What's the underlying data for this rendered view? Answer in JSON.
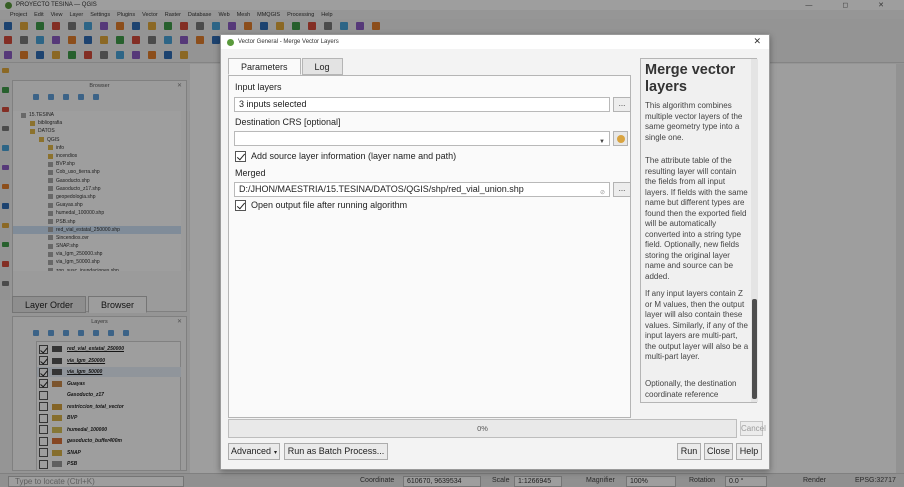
{
  "window": {
    "title": "PROYECTO TESINA — QGIS",
    "controls": "—  ◻  ✕"
  },
  "menubar": [
    "Project",
    "Edit",
    "View",
    "Layer",
    "Settings",
    "Plugins",
    "Vector",
    "Raster",
    "Database",
    "Web",
    "Mesh",
    "MMQGIS",
    "Processing",
    "Help"
  ],
  "browser_panel": {
    "title": "Browser",
    "close": "✕",
    "tree": [
      {
        "label": "15.TESINA",
        "indent": 0
      },
      {
        "label": "bibliografia",
        "indent": 1
      },
      {
        "label": "DATOS",
        "indent": 1
      },
      {
        "label": "QGIS",
        "indent": 2
      },
      {
        "label": "info",
        "indent": 3
      },
      {
        "label": "incendios",
        "indent": 3
      },
      {
        "label": "BVP.shp",
        "indent": 3
      },
      {
        "label": "Cob_uso_tierra.shp",
        "indent": 3
      },
      {
        "label": "Gasoducto.shp",
        "indent": 3
      },
      {
        "label": "Gasoducto_z17.shp",
        "indent": 3
      },
      {
        "label": "geopedologia.shp",
        "indent": 3
      },
      {
        "label": "Guayas.shp",
        "indent": 3
      },
      {
        "label": "humedal_100000.shp",
        "indent": 3
      },
      {
        "label": "PSB.shp",
        "indent": 3
      },
      {
        "label": "red_vial_estatal_250000.shp",
        "indent": 3,
        "selected": true
      },
      {
        "label": "Sincendios.ovr",
        "indent": 3
      },
      {
        "label": "SNAP.shp",
        "indent": 3
      },
      {
        "label": "via_Igm_250000.shp",
        "indent": 3
      },
      {
        "label": "via_Igm_50000.shp",
        "indent": 3
      },
      {
        "label": "zon_susc_inundaciones.shp",
        "indent": 3
      },
      {
        "label": "IGM",
        "indent": 2
      }
    ]
  },
  "panel_tabs": [
    "Layer Order",
    "Browser"
  ],
  "layers_panel": {
    "title": "Layers",
    "close": "✕",
    "layers": [
      {
        "name": "red_vial_estatal_250000",
        "checked": true,
        "color": "#555555",
        "underline": true,
        "highlight": false
      },
      {
        "name": "via_Igm_250000",
        "checked": true,
        "color": "#555555",
        "underline": true,
        "highlight": false
      },
      {
        "name": "via_Igm_50000",
        "checked": true,
        "color": "#555555",
        "underline": true,
        "highlight": true
      },
      {
        "name": "Guayas",
        "checked": true,
        "color": "#c98a4b",
        "underline": false,
        "highlight": false
      },
      {
        "name": "Gasoducto_z17",
        "checked": false,
        "color": "",
        "underline": false,
        "highlight": false
      },
      {
        "name": "restriccion_total_vector",
        "checked": false,
        "color": "#d4a13c",
        "underline": false,
        "highlight": false
      },
      {
        "name": "BVP",
        "checked": false,
        "color": "#d8b24a",
        "underline": false,
        "highlight": false
      },
      {
        "name": "humedal_100000",
        "checked": false,
        "color": "#d9c058",
        "underline": false,
        "highlight": false
      },
      {
        "name": "gasoducto_buffer400m",
        "checked": false,
        "color": "#d9733a",
        "underline": false,
        "highlight": false
      },
      {
        "name": "SNAP",
        "checked": false,
        "color": "#d8b24a",
        "underline": false,
        "highlight": false
      },
      {
        "name": "PSB",
        "checked": false,
        "color": "#9a9a9a",
        "underline": false,
        "highlight": false
      }
    ]
  },
  "statusbar": {
    "locate_placeholder": "Type to locate (Ctrl+K)",
    "coordinate_label": "Coordinate",
    "coordinate_value": "610670, 9639534",
    "scale_label": "Scale",
    "scale_value": "1:1266945",
    "magnifier_label": "Magnifier",
    "magnifier_value": "100%",
    "rotation_label": "Rotation",
    "rotation_value": "0.0 °",
    "render_label": "Render",
    "crs": "EPSG:32717"
  },
  "dialog": {
    "title": "Vector General - Merge Vector Layers",
    "close": "✕",
    "tabs": [
      "Parameters",
      "Log"
    ],
    "input_layers_label": "Input layers",
    "input_layers_value": "3 inputs selected",
    "ellipsis": "...",
    "crs_label": "Destination CRS [optional]",
    "crs_value": "",
    "add_source_label": "Add source layer information (layer name and path)",
    "add_source_checked": true,
    "merged_label": "Merged",
    "merged_value": "D:/JHON/MAESTRIA/15.TESINA/DATOS/QGIS/shp/red_vial_union.shp",
    "open_output_label": "Open output file after running algorithm",
    "open_output_checked": true,
    "help": {
      "title": "Merge vector layers",
      "paragraphs": [
        "This algorithm combines multiple vector layers of the same geometry type into a single one.",
        "The attribute table of the resulting layer will contain the fields from all input layers. If fields with the same name but different types are found then the exported field will be automatically converted into a string type field. Optionally, new fields storing the original layer name and source can be added.",
        "If any input layers contain Z or M values, then the output layer will also contain these values. Similarly, if any of the input layers are multi-part, the output layer will also be a multi-part layer.",
        "Optionally, the destination coordinate reference"
      ]
    },
    "progress_percent": 0,
    "progress_label": "0%",
    "cancel_label": "Cancel",
    "advanced_label": "Advanced",
    "batch_label": "Run as Batch Process...",
    "run_label": "Run",
    "close_label": "Close",
    "help_label": "Help"
  },
  "colors": {
    "accent_green": "#5a9a3c",
    "highlight_blue": "#cfe3f7"
  }
}
